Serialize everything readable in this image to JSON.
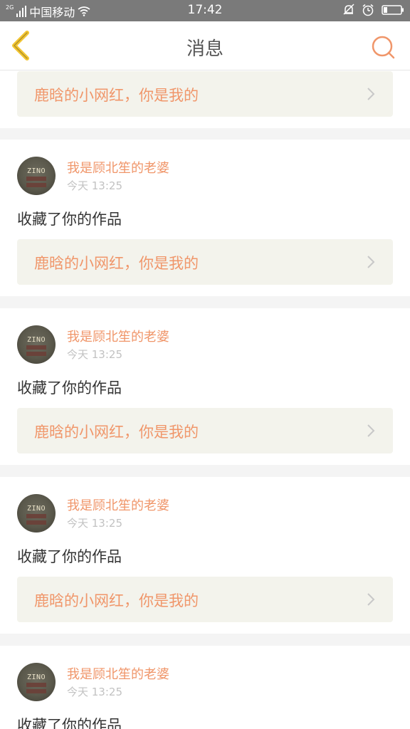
{
  "status_bar": {
    "network_badge": "2G",
    "carrier": "中国移动",
    "time": "17:42",
    "icons": [
      "signal-icon",
      "wifi-icon",
      "bell-off-icon",
      "alarm-clock-icon",
      "battery-icon"
    ]
  },
  "nav": {
    "title": "消息",
    "back_icon": "chevron-left-icon",
    "search_icon": "search-icon"
  },
  "colors": {
    "accent": "#f0966a",
    "back_arrow": "#f2c531",
    "card_link_bg": "#f3f3ec"
  },
  "messages": [
    {
      "link_text": "鹿晗的小网红，你是我的"
    },
    {
      "username": "我是顾北笙的老婆",
      "time": "今天 13:25",
      "action": "收藏了你的作品",
      "link_text": "鹿晗的小网红，你是我的"
    },
    {
      "username": "我是顾北笙的老婆",
      "time": "今天 13:25",
      "action": "收藏了你的作品",
      "link_text": "鹿晗的小网红，你是我的"
    },
    {
      "username": "我是顾北笙的老婆",
      "time": "今天 13:25",
      "action": "收藏了你的作品",
      "link_text": "鹿晗的小网红，你是我的"
    },
    {
      "username": "我是顾北笙的老婆",
      "time": "今天 13:25",
      "action": "收藏了你的作品"
    }
  ],
  "avatar_label": "ZINO"
}
